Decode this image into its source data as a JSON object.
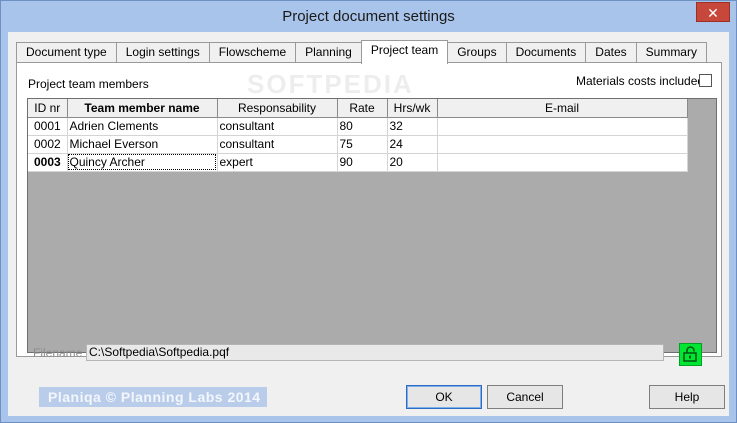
{
  "window": {
    "title": "Project document settings",
    "close_glyph": "✕"
  },
  "tabs": [
    {
      "label": "Document type",
      "active": false
    },
    {
      "label": "Login settings",
      "active": false
    },
    {
      "label": "Flowscheme",
      "active": false
    },
    {
      "label": "Planning",
      "active": false
    },
    {
      "label": "Project team",
      "active": true
    },
    {
      "label": "Groups",
      "active": false
    },
    {
      "label": "Documents",
      "active": false
    },
    {
      "label": "Dates",
      "active": false
    },
    {
      "label": "Summary",
      "active": false
    }
  ],
  "panel": {
    "watermark": "SOFTPEDIA",
    "members_label": "Project team members",
    "materials_label": "Materials costs included",
    "materials_checked": false
  },
  "table": {
    "columns": [
      "ID nr",
      "Team member name",
      "Responsability",
      "Rate",
      "Hrs/wk",
      "E-mail"
    ],
    "rows": [
      [
        "0001",
        "Adrien Clements",
        "consultant",
        "80",
        "32",
        ""
      ],
      [
        "0002",
        "Michael Everson",
        "consultant",
        "75",
        "24",
        ""
      ],
      [
        "0003",
        "Quincy Archer",
        "expert",
        "90",
        "20",
        ""
      ]
    ]
  },
  "file": {
    "label": "Filename",
    "value": "C:\\Softpedia\\Softpedia.pqf",
    "lock_icon": "unlock-icon",
    "lock_color": "#00e632"
  },
  "footer": {
    "branding": "Planiqa    © Planning Labs 2014",
    "ok_label": "OK",
    "cancel_label": "Cancel",
    "help_label": "Help"
  },
  "colors": {
    "frame": "#a9c4ea",
    "grid_empty": "#ababab"
  }
}
